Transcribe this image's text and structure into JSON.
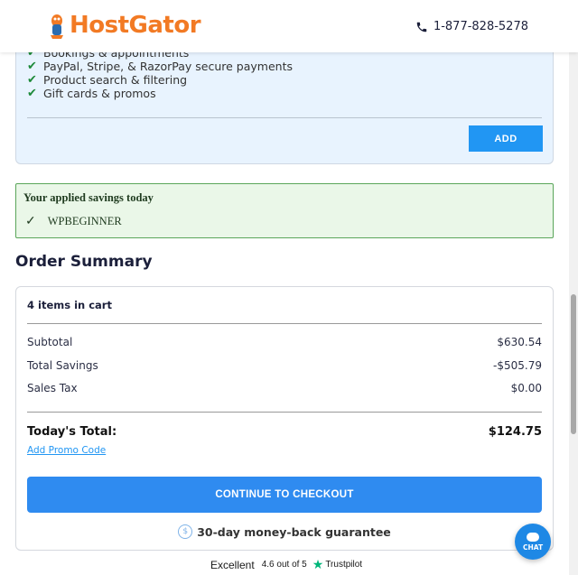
{
  "header": {
    "logo_text": "HostGator",
    "phone": "1-877-828-5278"
  },
  "addon": {
    "features": [
      "Bookings & appointments",
      "PayPal, Stripe, & RazorPay  secure payments",
      "Product search & filtering",
      "Gift cards & promos"
    ],
    "add_label": "ADD"
  },
  "savings": {
    "title": "Your applied savings today",
    "code": "WPBEGINNER"
  },
  "order": {
    "title": "Order Summary",
    "cart_count": "4 items in cart",
    "rows": [
      {
        "label": "Subtotal",
        "value": "$630.54"
      },
      {
        "label": "Total Savings",
        "value": "-$505.79"
      },
      {
        "label": "Sales Tax",
        "value": "$0.00"
      }
    ],
    "total_label": "Today's Total:",
    "total_value": "$124.75",
    "promo_link": "Add Promo Code",
    "checkout_label": "CONTINUE TO CHECKOUT",
    "guarantee": "30-day money-back guarantee"
  },
  "trust": {
    "excellent": "Excellent",
    "score": "4.6 out of 5",
    "brand": "Trustpilot"
  },
  "chat": {
    "label": "CHAT"
  },
  "colors": {
    "brand_orange": "#f27a24",
    "accent_blue": "#2196f3",
    "success_green": "#5aa65a"
  }
}
